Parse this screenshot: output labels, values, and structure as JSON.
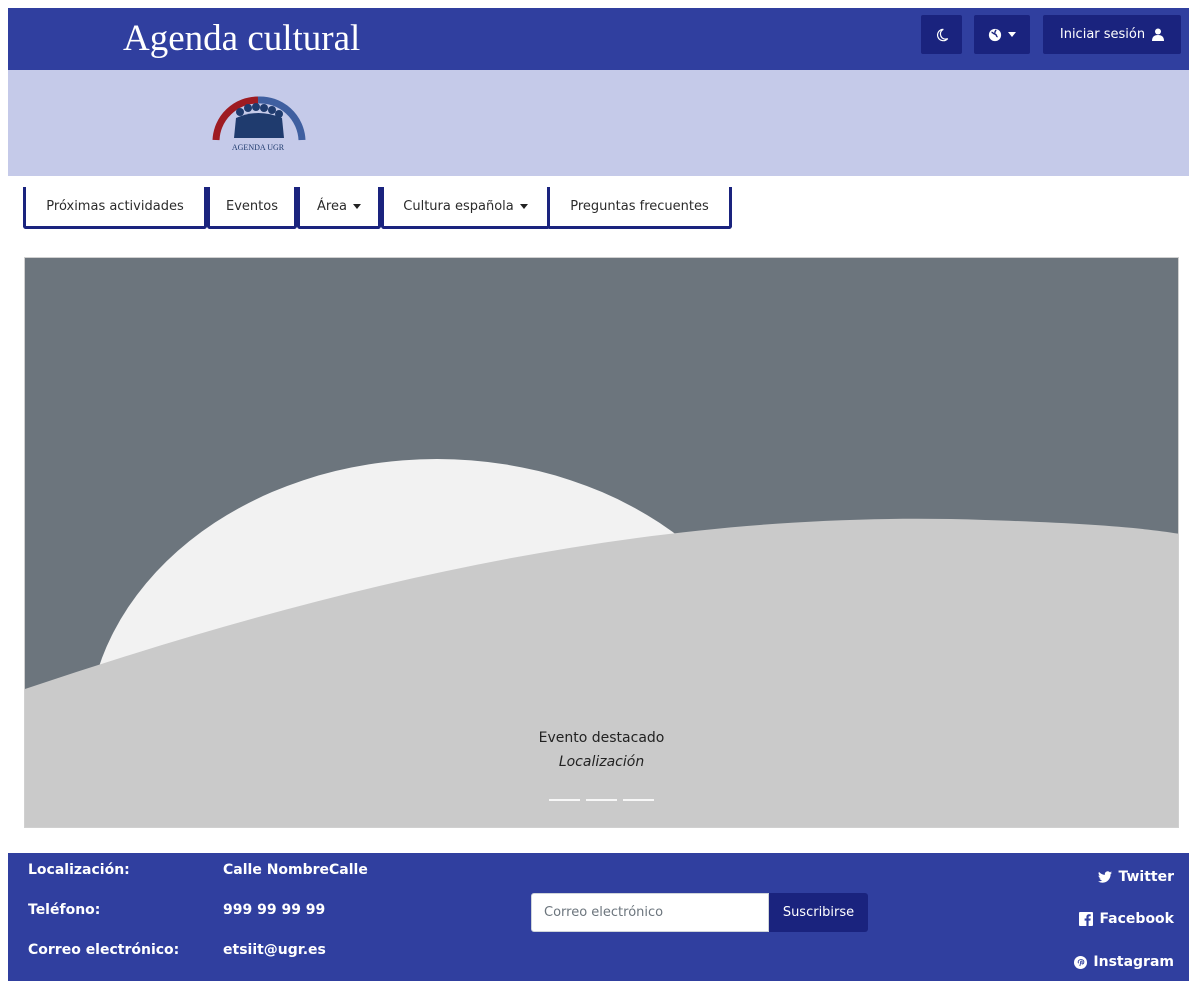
{
  "header": {
    "site_title": "Agenda cultural",
    "dark_mode_icon": "moon-icon",
    "language_icon": "globe-icon",
    "login_label": "Iniciar sesión",
    "login_icon": "user-icon",
    "colors": {
      "primary": "#303f9f",
      "button": "#1a237e"
    }
  },
  "banner": {
    "logo_text": "AGENDA UGR",
    "background": "#c5cae9"
  },
  "nav": {
    "items": [
      {
        "label": "Próximas actividades",
        "dropdown": false
      },
      {
        "label": "Eventos",
        "dropdown": false
      },
      {
        "label": "Área",
        "dropdown": true
      },
      {
        "label": "Cultura española",
        "dropdown": true
      },
      {
        "label": "Preguntas frecuentes",
        "dropdown": false
      }
    ]
  },
  "carousel": {
    "caption_title": "Evento destacado",
    "caption_location": "Localización",
    "indicator_count": 3
  },
  "footer": {
    "contact": [
      {
        "label": "Localización:",
        "value": "Calle NombreCalle"
      },
      {
        "label": "Teléfono:",
        "value": "999 99 99 99"
      },
      {
        "label": "Correo electrónico:",
        "value": "etsiit@ugr.es"
      }
    ],
    "newsletter": {
      "placeholder": "Correo electrónico",
      "button_label": "Suscribirse"
    },
    "social": [
      {
        "label": "Twitter",
        "icon": "twitter-icon"
      },
      {
        "label": "Facebook",
        "icon": "facebook-icon"
      },
      {
        "label": "Instagram",
        "icon": "pinterest-icon"
      }
    ]
  }
}
